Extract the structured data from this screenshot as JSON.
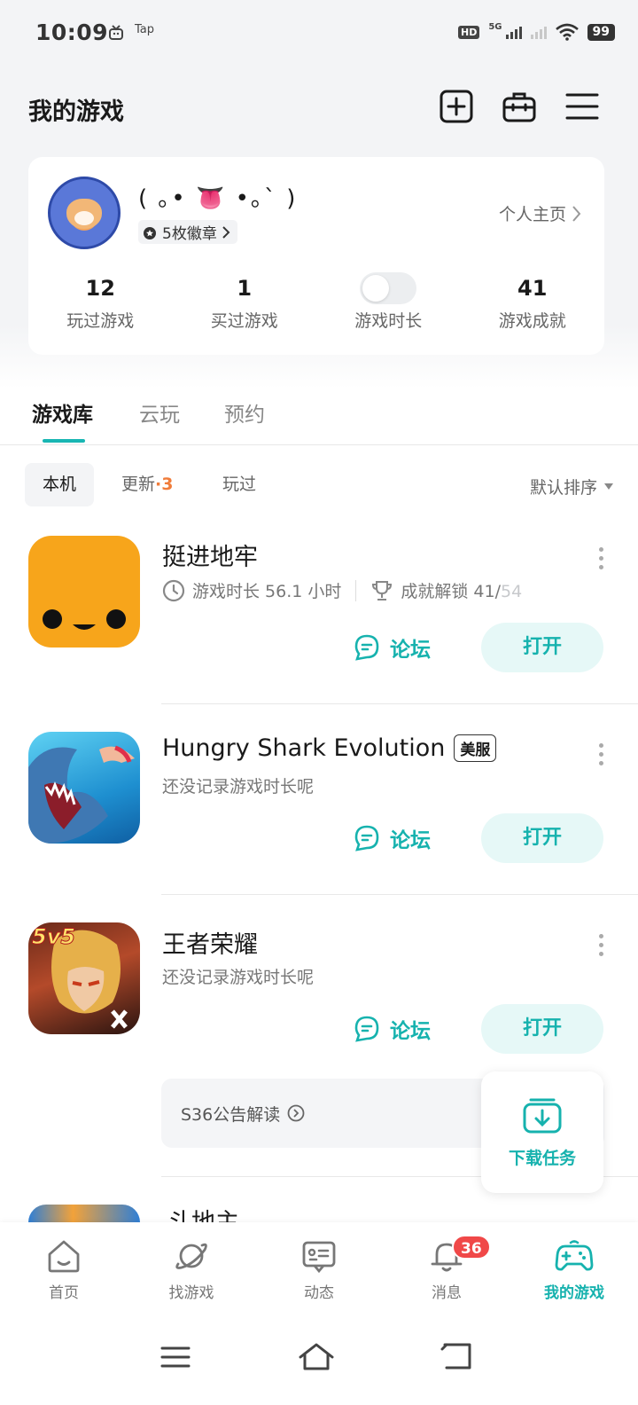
{
  "status_bar": {
    "time": "10:09",
    "notif_label": "Tap",
    "hd_label": "HD",
    "network": "5G",
    "battery": "99"
  },
  "header": {
    "title": "我的游戏",
    "icons": [
      "add-square-icon",
      "toolbox-icon",
      "menu-icon"
    ]
  },
  "profile": {
    "nickname": "( ｡• 👅 •｡` )",
    "badges": "5枚徽章",
    "homepage_link": "个人主页",
    "stats": [
      {
        "value": "12",
        "label": "玩过游戏"
      },
      {
        "value": "1",
        "label": "买过游戏"
      },
      {
        "toggle_on": false,
        "label": "游戏时长"
      },
      {
        "value": "41",
        "label": "游戏成就"
      }
    ]
  },
  "tabs": [
    {
      "label": "游戏库",
      "active": true
    },
    {
      "label": "云玩",
      "active": false
    },
    {
      "label": "预约",
      "active": false
    }
  ],
  "filters": {
    "local": "本机",
    "updates": "更新",
    "updates_count": "·3",
    "played": "玩过",
    "sort": "默认排序"
  },
  "games": [
    {
      "name": "挺进地牢",
      "playtime": "游戏时长 56.1 小时",
      "achievements_label": "成就解锁 41/",
      "achievements_total": "54",
      "forum": "论坛",
      "open": "打开"
    },
    {
      "name": "Hungry Shark Evolution",
      "tag": "美服",
      "note": "还没记录游戏时长呢",
      "forum": "论坛",
      "open": "打开"
    },
    {
      "name": "王者荣耀",
      "note": "还没记录游戏时长呢",
      "forum": "论坛",
      "open": "打开",
      "notice": "S36公告解读",
      "icon_badge": "5v5"
    },
    {
      "name": "斗地主"
    }
  ],
  "download_tasks": "下载任务",
  "bottom_nav": [
    {
      "label": "首页",
      "icon": "home-icon"
    },
    {
      "label": "找游戏",
      "icon": "planet-icon"
    },
    {
      "label": "动态",
      "icon": "feed-icon"
    },
    {
      "label": "消息",
      "icon": "bell-icon",
      "badge": "36"
    },
    {
      "label": "我的游戏",
      "icon": "gamepad-icon",
      "active": true
    }
  ],
  "colors": {
    "accent": "#16b2ae",
    "accent_bg": "#e6f8f7",
    "update_orange": "#f07c3a",
    "badge_red": "#f04848"
  }
}
